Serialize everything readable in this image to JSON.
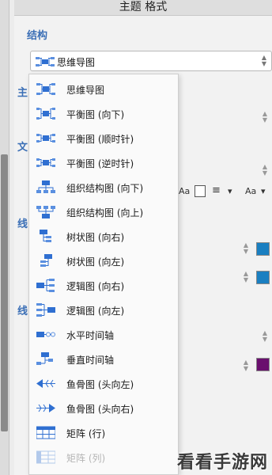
{
  "panel": {
    "title": "主题 格式",
    "section_structure": "结构",
    "select": {
      "value": "思维导图",
      "icon": "mindmap-icon"
    },
    "peek_labels": [
      "主",
      "文",
      "线",
      "线"
    ]
  },
  "colors": {
    "accent": "#3b6fb6",
    "swatch_blue": "#1a7fc1",
    "swatch_purple": "#6a0f6e",
    "icon_blue": "#2f6fd1"
  },
  "format_toolbar": {
    "font_a": "Aa",
    "align": "≡",
    "caret": "▾",
    "font_b": "Aa"
  },
  "menu": {
    "items": [
      {
        "label": "思维导图",
        "icon": "mindmap-icon",
        "enabled": true
      },
      {
        "label": "平衡图 (向下)",
        "icon": "balance-down-icon",
        "enabled": true
      },
      {
        "label": "平衡图 (顺时针)",
        "icon": "balance-clockwise-icon",
        "enabled": true
      },
      {
        "label": "平衡图 (逆时针)",
        "icon": "balance-counterclockwise-icon",
        "enabled": true
      },
      {
        "label": "组织结构图 (向下)",
        "icon": "org-chart-down-icon",
        "enabled": true
      },
      {
        "label": "组织结构图 (向上)",
        "icon": "org-chart-up-icon",
        "enabled": true
      },
      {
        "label": "树状图 (向右)",
        "icon": "tree-right-icon",
        "enabled": true
      },
      {
        "label": "树状图 (向左)",
        "icon": "tree-left-icon",
        "enabled": true
      },
      {
        "label": "逻辑图 (向右)",
        "icon": "logic-right-icon",
        "enabled": true
      },
      {
        "label": "逻辑图 (向左)",
        "icon": "logic-left-icon",
        "enabled": true
      },
      {
        "label": "水平时间轴",
        "icon": "horizontal-timeline-icon",
        "enabled": true
      },
      {
        "label": "垂直时间轴",
        "icon": "vertical-timeline-icon",
        "enabled": true
      },
      {
        "label": "鱼骨图 (头向左)",
        "icon": "fishbone-left-icon",
        "enabled": true
      },
      {
        "label": "鱼骨图 (头向右)",
        "icon": "fishbone-right-icon",
        "enabled": true
      },
      {
        "label": "矩阵 (行)",
        "icon": "matrix-rows-icon",
        "enabled": true
      },
      {
        "label": "矩阵 (列)",
        "icon": "matrix-columns-icon",
        "enabled": false
      }
    ]
  },
  "watermark": "看看手游网"
}
